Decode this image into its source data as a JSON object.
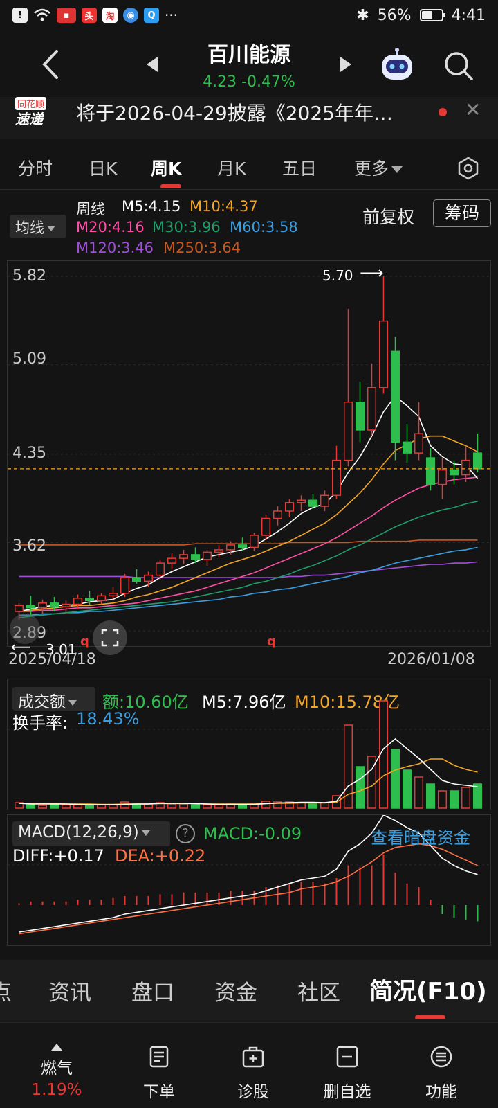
{
  "status_bar": {
    "battery": "56%",
    "time": "4:41",
    "battery_level": 0.56
  },
  "header": {
    "stock_name": "百川能源",
    "price_line": "4.23 -0.47%"
  },
  "news": {
    "text": "将于2026-04-29披露《2025年年…",
    "logo_top": "同花顺",
    "logo_bottom": "速递"
  },
  "period_tabs": {
    "items": [
      "分时",
      "日K",
      "周K",
      "月K",
      "五日",
      "更多"
    ],
    "active": "周K"
  },
  "ma_panel": {
    "selector": "均线",
    "period": "周线",
    "m5": "M5:4.15",
    "m10": "M10:4.37",
    "m20": "M20:4.16",
    "m30": "M30:3.96",
    "m60": "M60:3.58",
    "m120": "M120:3.46",
    "m250": "M250:3.64",
    "fuquan": "前复权",
    "chouma": "筹码"
  },
  "colors": {
    "up": "#e53935",
    "down": "#2dbe4d",
    "m5": "#ffffff",
    "m10": "#f5a623",
    "m20": "#ff4fa6",
    "m30": "#1e9e6b",
    "m60": "#3a9de0",
    "m120": "#a050d8",
    "m250": "#c8581f"
  },
  "price_axis": {
    "labels": [
      "5.82",
      "5.09",
      "4.35",
      "3.62",
      "2.89"
    ]
  },
  "price_annotations": {
    "high": "5.70",
    "low": "3.01"
  },
  "date_axis": {
    "start": "2025/04/18",
    "end": "2026/01/08"
  },
  "volume": {
    "selector": "成交额",
    "amount": "额:10.60亿",
    "m5": "M5:7.96亿",
    "m10": "M10:15.78亿",
    "turnover_label": "换手率:",
    "turnover_value": "18.43%"
  },
  "macd": {
    "selector": "MACD(12,26,9)",
    "help": "?",
    "macd_value": "MACD:-0.09",
    "link": "查看暗盘资金",
    "diff": "DIFF:+0.17",
    "dea": "DEA:+0.22"
  },
  "bottom_tabs": {
    "items": [
      "点",
      "资讯",
      "盘口",
      "资金",
      "社区",
      "简况(F10)"
    ]
  },
  "actions": {
    "gas_label": "燃气",
    "gas_value": "1.19%",
    "order": "下单",
    "diagnose": "诊股",
    "remove": "删自选",
    "features": "功能"
  },
  "chart_data": {
    "type": "candlestick",
    "x_start": "2025/04/18",
    "x_end": "2026/01/08",
    "ylim": [
      2.89,
      5.82
    ],
    "candles": [
      [
        3.05,
        3.12,
        2.98,
        3.1
      ],
      [
        3.1,
        3.18,
        3.01,
        3.08
      ],
      [
        3.08,
        3.15,
        3.02,
        3.12
      ],
      [
        3.12,
        3.17,
        3.05,
        3.09
      ],
      [
        3.09,
        3.14,
        3.04,
        3.11
      ],
      [
        3.11,
        3.19,
        3.07,
        3.16
      ],
      [
        3.16,
        3.22,
        3.1,
        3.14
      ],
      [
        3.14,
        3.2,
        3.11,
        3.18
      ],
      [
        3.18,
        3.25,
        3.14,
        3.2
      ],
      [
        3.2,
        3.36,
        3.17,
        3.33
      ],
      [
        3.33,
        3.4,
        3.28,
        3.3
      ],
      [
        3.3,
        3.38,
        3.25,
        3.35
      ],
      [
        3.35,
        3.48,
        3.31,
        3.45
      ],
      [
        3.45,
        3.53,
        3.4,
        3.49
      ],
      [
        3.49,
        3.56,
        3.44,
        3.52
      ],
      [
        3.52,
        3.58,
        3.45,
        3.48
      ],
      [
        3.48,
        3.56,
        3.43,
        3.54
      ],
      [
        3.54,
        3.6,
        3.5,
        3.56
      ],
      [
        3.56,
        3.63,
        3.52,
        3.6
      ],
      [
        3.6,
        3.66,
        3.55,
        3.58
      ],
      [
        3.58,
        3.7,
        3.55,
        3.68
      ],
      [
        3.68,
        3.85,
        3.64,
        3.82
      ],
      [
        3.82,
        3.92,
        3.76,
        3.88
      ],
      [
        3.88,
        3.98,
        3.83,
        3.95
      ],
      [
        3.95,
        4.01,
        3.88,
        3.97
      ],
      [
        3.97,
        4.02,
        3.9,
        3.92
      ],
      [
        3.92,
        4.05,
        3.88,
        4.01
      ],
      [
        4.01,
        4.42,
        3.98,
        4.3
      ],
      [
        4.3,
        5.55,
        4.25,
        4.78
      ],
      [
        4.78,
        4.95,
        4.45,
        4.55
      ],
      [
        4.55,
        5.1,
        4.5,
        4.9
      ],
      [
        4.9,
        5.82,
        4.85,
        5.45
      ],
      [
        5.2,
        5.32,
        4.3,
        4.45
      ],
      [
        4.45,
        4.6,
        4.28,
        4.36
      ],
      [
        4.36,
        4.78,
        4.3,
        4.52
      ],
      [
        4.32,
        4.4,
        4.05,
        4.1
      ],
      [
        4.1,
        4.32,
        3.98,
        4.22
      ],
      [
        4.22,
        4.3,
        4.1,
        4.18
      ],
      [
        4.18,
        4.42,
        4.12,
        4.3
      ],
      [
        4.36,
        4.52,
        4.2,
        4.23
      ]
    ],
    "ma": {
      "M5": [
        3.05,
        3.07,
        3.09,
        3.1,
        3.1,
        3.11,
        3.13,
        3.14,
        3.15,
        3.2,
        3.24,
        3.27,
        3.33,
        3.38,
        3.42,
        3.46,
        3.5,
        3.52,
        3.54,
        3.56,
        3.59,
        3.65,
        3.71,
        3.78,
        3.86,
        3.91,
        3.94,
        4.04,
        4.2,
        4.33,
        4.5,
        4.7,
        4.83,
        4.75,
        4.66,
        4.42,
        4.33,
        4.27,
        4.26,
        4.15
      ],
      "M10": [
        3.05,
        3.06,
        3.07,
        3.08,
        3.09,
        3.1,
        3.1,
        3.11,
        3.12,
        3.14,
        3.17,
        3.19,
        3.22,
        3.25,
        3.29,
        3.33,
        3.37,
        3.41,
        3.45,
        3.48,
        3.51,
        3.55,
        3.59,
        3.63,
        3.68,
        3.73,
        3.78,
        3.85,
        3.94,
        4.03,
        4.14,
        4.27,
        4.38,
        4.43,
        4.48,
        4.5,
        4.5,
        4.46,
        4.42,
        4.37
      ],
      "M20": [
        3.05,
        3.05,
        3.06,
        3.06,
        3.07,
        3.08,
        3.08,
        3.09,
        3.1,
        3.11,
        3.12,
        3.14,
        3.16,
        3.18,
        3.2,
        3.22,
        3.25,
        3.28,
        3.31,
        3.34,
        3.37,
        3.41,
        3.45,
        3.49,
        3.53,
        3.57,
        3.61,
        3.66,
        3.72,
        3.78,
        3.84,
        3.91,
        3.97,
        4.02,
        4.07,
        4.1,
        4.12,
        4.14,
        4.15,
        4.16
      ],
      "M30": [
        3.0,
        3.01,
        3.02,
        3.03,
        3.04,
        3.05,
        3.06,
        3.07,
        3.08,
        3.09,
        3.1,
        3.11,
        3.12,
        3.13,
        3.15,
        3.17,
        3.19,
        3.21,
        3.23,
        3.25,
        3.28,
        3.3,
        3.33,
        3.36,
        3.4,
        3.43,
        3.47,
        3.51,
        3.56,
        3.6,
        3.65,
        3.7,
        3.75,
        3.79,
        3.83,
        3.86,
        3.89,
        3.91,
        3.94,
        3.96
      ],
      "M60": [
        3.02,
        3.02,
        3.03,
        3.03,
        3.04,
        3.04,
        3.05,
        3.05,
        3.06,
        3.07,
        3.08,
        3.09,
        3.1,
        3.11,
        3.12,
        3.13,
        3.14,
        3.15,
        3.17,
        3.18,
        3.2,
        3.21,
        3.23,
        3.24,
        3.26,
        3.28,
        3.3,
        3.32,
        3.34,
        3.37,
        3.39,
        3.42,
        3.45,
        3.47,
        3.49,
        3.51,
        3.53,
        3.55,
        3.56,
        3.58
      ],
      "M120": [
        3.34,
        3.34,
        3.34,
        3.34,
        3.34,
        3.34,
        3.34,
        3.34,
        3.34,
        3.34,
        3.33,
        3.33,
        3.33,
        3.33,
        3.33,
        3.33,
        3.33,
        3.33,
        3.33,
        3.33,
        3.33,
        3.33,
        3.33,
        3.34,
        3.34,
        3.35,
        3.35,
        3.36,
        3.37,
        3.38,
        3.39,
        3.4,
        3.41,
        3.42,
        3.43,
        3.44,
        3.44,
        3.45,
        3.45,
        3.46
      ],
      "M250": [
        3.6,
        3.6,
        3.6,
        3.6,
        3.6,
        3.6,
        3.6,
        3.6,
        3.6,
        3.6,
        3.6,
        3.6,
        3.6,
        3.6,
        3.6,
        3.61,
        3.61,
        3.61,
        3.61,
        3.61,
        3.61,
        3.61,
        3.61,
        3.62,
        3.62,
        3.62,
        3.62,
        3.62,
        3.62,
        3.63,
        3.63,
        3.63,
        3.63,
        3.63,
        3.64,
        3.64,
        3.64,
        3.64,
        3.64,
        3.64
      ]
    },
    "volume_yi": [
      0.8,
      0.5,
      0.4,
      0.6,
      0.5,
      0.5,
      0.4,
      0.5,
      0.5,
      0.9,
      0.6,
      0.6,
      0.8,
      0.6,
      0.6,
      0.5,
      0.5,
      0.5,
      0.6,
      0.5,
      0.6,
      1.0,
      0.9,
      0.9,
      0.8,
      0.6,
      0.8,
      1.8,
      12.0,
      6.0,
      7.5,
      15.5,
      8.5,
      5.5,
      4.5,
      3.5,
      2.5,
      2.5,
      3.0,
      3.5
    ],
    "volume_m5": [
      0.7,
      0.6,
      0.6,
      0.6,
      0.6,
      0.55,
      0.5,
      0.5,
      0.5,
      0.55,
      0.6,
      0.6,
      0.7,
      0.7,
      0.7,
      0.65,
      0.6,
      0.55,
      0.55,
      0.55,
      0.55,
      0.65,
      0.75,
      0.8,
      0.85,
      0.85,
      0.8,
      1.0,
      3.2,
      4.2,
      5.6,
      8.6,
      10.0,
      8.6,
      7.2,
      5.6,
      4.0,
      3.5,
      3.3,
      3.1
    ],
    "volume_m10": [
      0.7,
      0.7,
      0.65,
      0.65,
      0.6,
      0.6,
      0.6,
      0.55,
      0.55,
      0.6,
      0.6,
      0.6,
      0.65,
      0.65,
      0.65,
      0.65,
      0.6,
      0.6,
      0.6,
      0.6,
      0.6,
      0.65,
      0.7,
      0.7,
      0.75,
      0.75,
      0.75,
      0.85,
      2.0,
      2.5,
      3.2,
      4.7,
      5.5,
      6.0,
      6.4,
      7.1,
      7.1,
      6.2,
      5.6,
      5.2
    ],
    "macd_hist": [
      0.01,
      0.02,
      0.02,
      0.02,
      0.02,
      0.03,
      0.03,
      0.03,
      0.04,
      0.05,
      0.05,
      0.05,
      0.06,
      0.06,
      0.07,
      0.07,
      0.07,
      0.07,
      0.08,
      0.08,
      0.08,
      0.1,
      0.11,
      0.12,
      0.13,
      0.13,
      0.12,
      0.15,
      0.22,
      0.21,
      0.22,
      0.28,
      0.18,
      0.12,
      0.1,
      0.03,
      -0.05,
      -0.07,
      -0.08,
      -0.09
    ],
    "macd_diff": [
      -0.15,
      -0.14,
      -0.13,
      -0.12,
      -0.11,
      -0.1,
      -0.09,
      -0.08,
      -0.07,
      -0.05,
      -0.04,
      -0.03,
      -0.02,
      -0.01,
      0.0,
      0.01,
      0.02,
      0.03,
      0.04,
      0.05,
      0.06,
      0.08,
      0.1,
      0.12,
      0.14,
      0.15,
      0.16,
      0.2,
      0.3,
      0.34,
      0.4,
      0.5,
      0.47,
      0.43,
      0.4,
      0.33,
      0.26,
      0.22,
      0.19,
      0.17
    ],
    "macd_dea": [
      -0.16,
      -0.15,
      -0.14,
      -0.13,
      -0.12,
      -0.11,
      -0.1,
      -0.09,
      -0.08,
      -0.07,
      -0.06,
      -0.05,
      -0.04,
      -0.03,
      -0.02,
      -0.01,
      0.0,
      0.01,
      0.02,
      0.03,
      0.04,
      0.05,
      0.06,
      0.07,
      0.09,
      0.1,
      0.11,
      0.13,
      0.16,
      0.2,
      0.24,
      0.29,
      0.32,
      0.33,
      0.34,
      0.33,
      0.31,
      0.28,
      0.25,
      0.22
    ]
  }
}
